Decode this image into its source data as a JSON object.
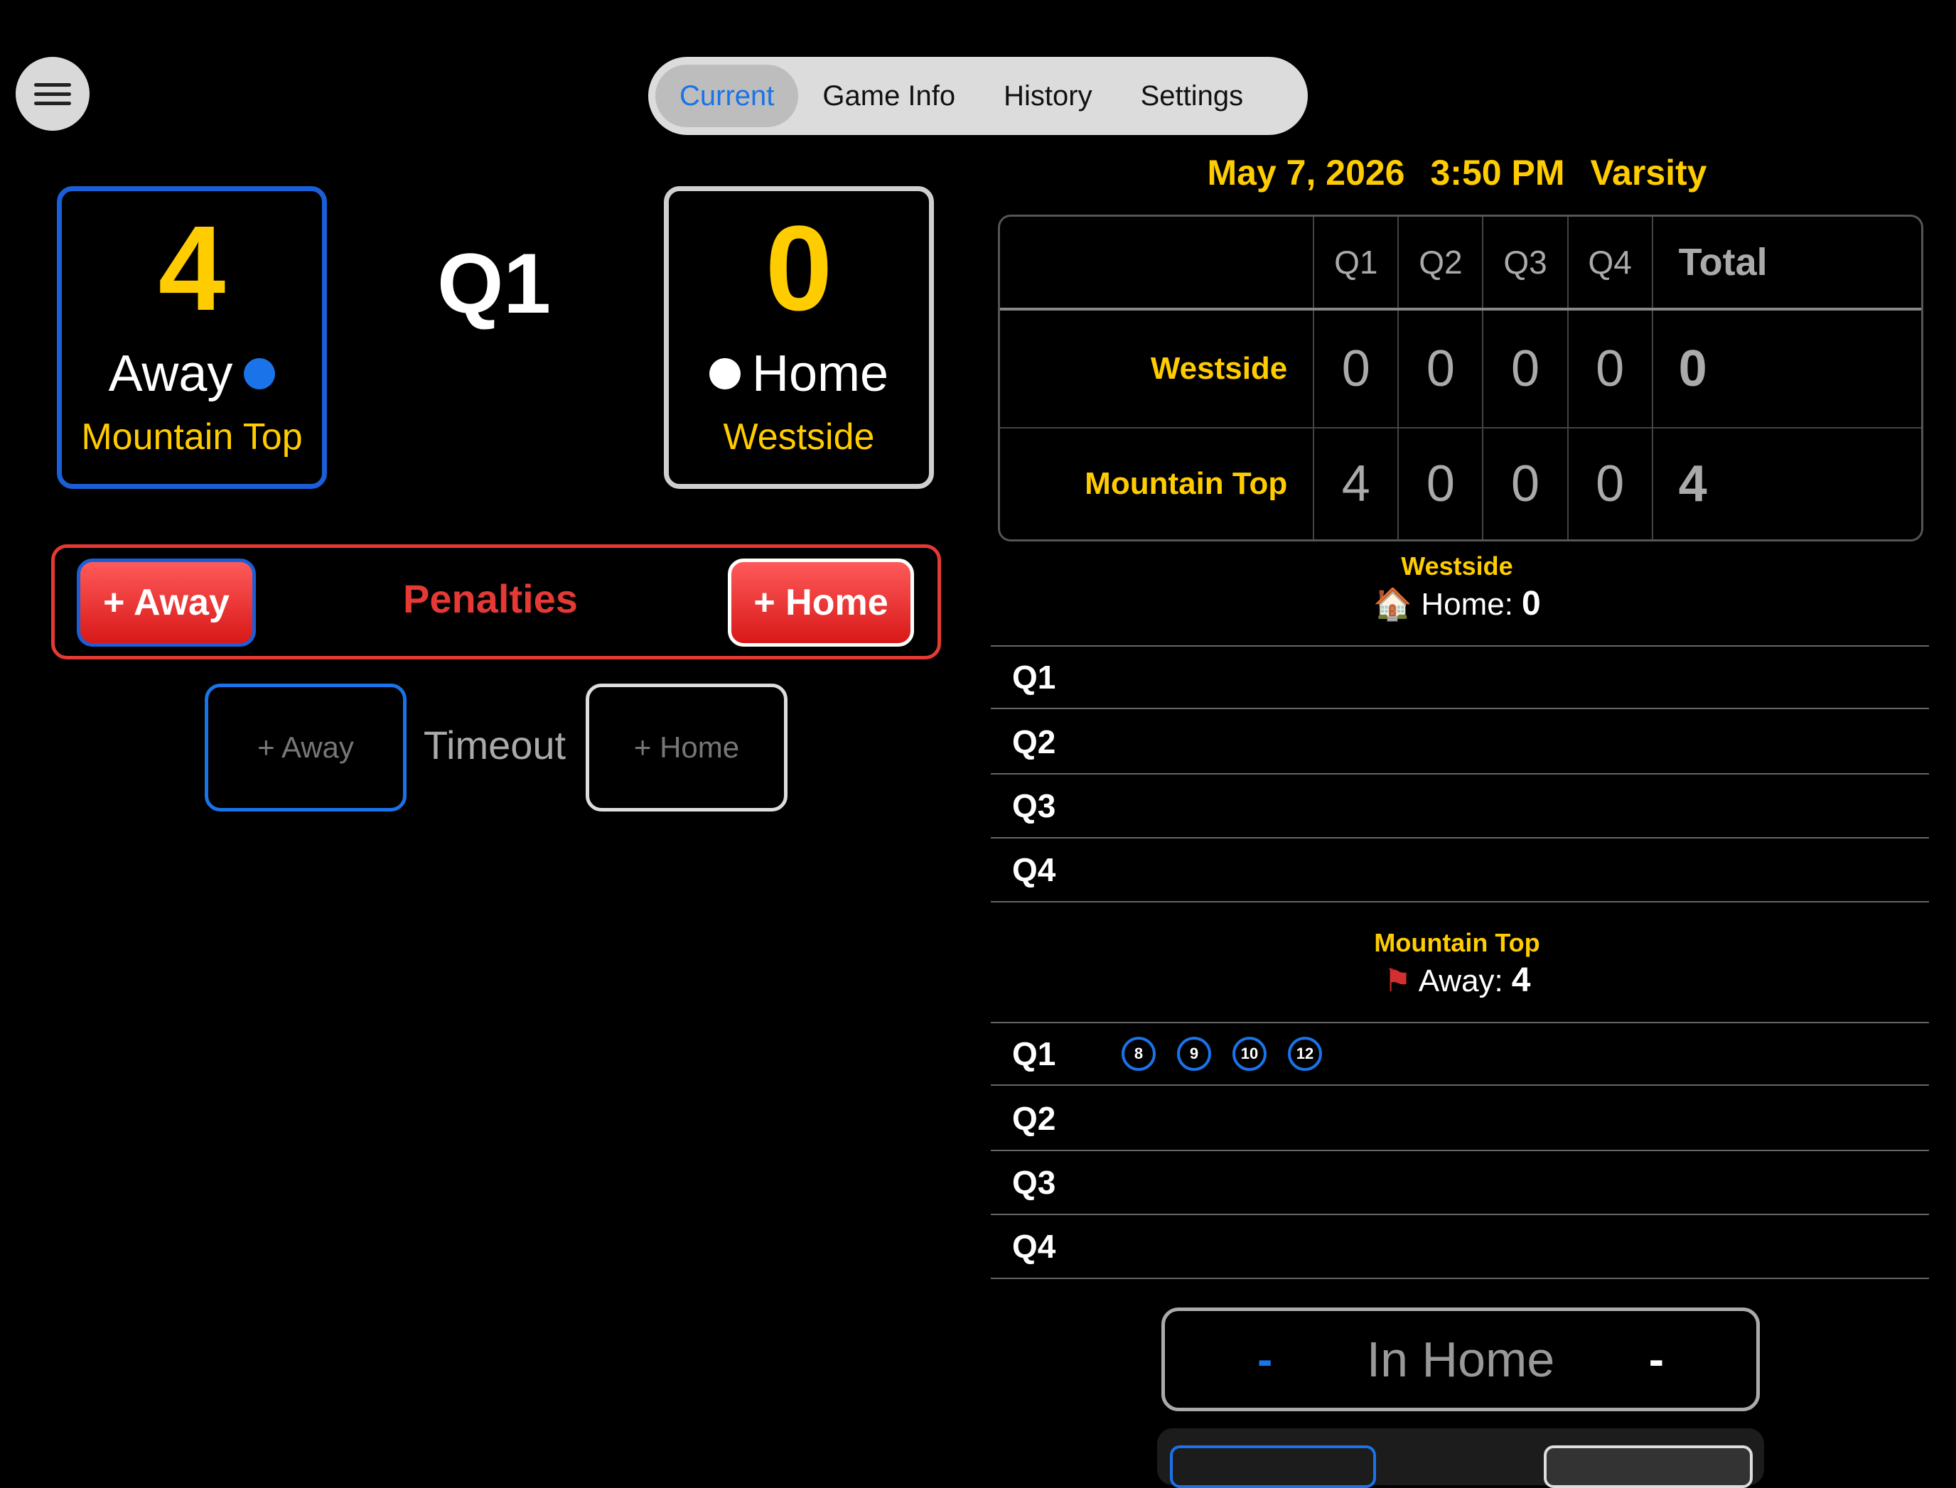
{
  "tabs": [
    "Current",
    "Game Info",
    "History",
    "Settings"
  ],
  "away": {
    "score": "4",
    "role": "Away",
    "team": "Mountain Top",
    "color": "#1a73e8"
  },
  "home": {
    "score": "0",
    "role": "Home",
    "team": "Westside",
    "color": "#ffffff"
  },
  "period": "Q1",
  "penalties": {
    "label": "Penalties",
    "away_btn": "+ Away",
    "home_btn": "+ Home"
  },
  "timeout": {
    "label": "Timeout",
    "away_btn": "+ Away",
    "home_btn": "+ Home"
  },
  "header": {
    "date": "May 7, 2026",
    "time": "3:50 PM",
    "level": "Varsity"
  },
  "box_score": {
    "columns": [
      "Q1",
      "Q2",
      "Q3",
      "Q4",
      "Total"
    ],
    "rows": [
      {
        "team": "Westside",
        "q": [
          "0",
          "0",
          "0",
          "0"
        ],
        "total": "0"
      },
      {
        "team": "Mountain Top",
        "q": [
          "4",
          "0",
          "0",
          "0"
        ],
        "total": "4"
      }
    ]
  },
  "home_section": {
    "team": "Westside",
    "icon": "house-icon",
    "label": "Home:",
    "score": "0",
    "quarters": [
      "Q1",
      "Q2",
      "Q3",
      "Q4"
    ]
  },
  "away_section": {
    "team": "Mountain Top",
    "icon": "red-flag-icon",
    "label": "Away:",
    "score": "4",
    "quarters": [
      "Q1",
      "Q2",
      "Q3",
      "Q4"
    ],
    "q1_players": [
      "8",
      "9",
      "10",
      "12"
    ]
  },
  "possession": {
    "label": "In Home",
    "left": "-",
    "right": "-"
  },
  "colors": {
    "accent": "#ffcc00",
    "away": "#1a73e8",
    "penalty": "#e53935"
  }
}
